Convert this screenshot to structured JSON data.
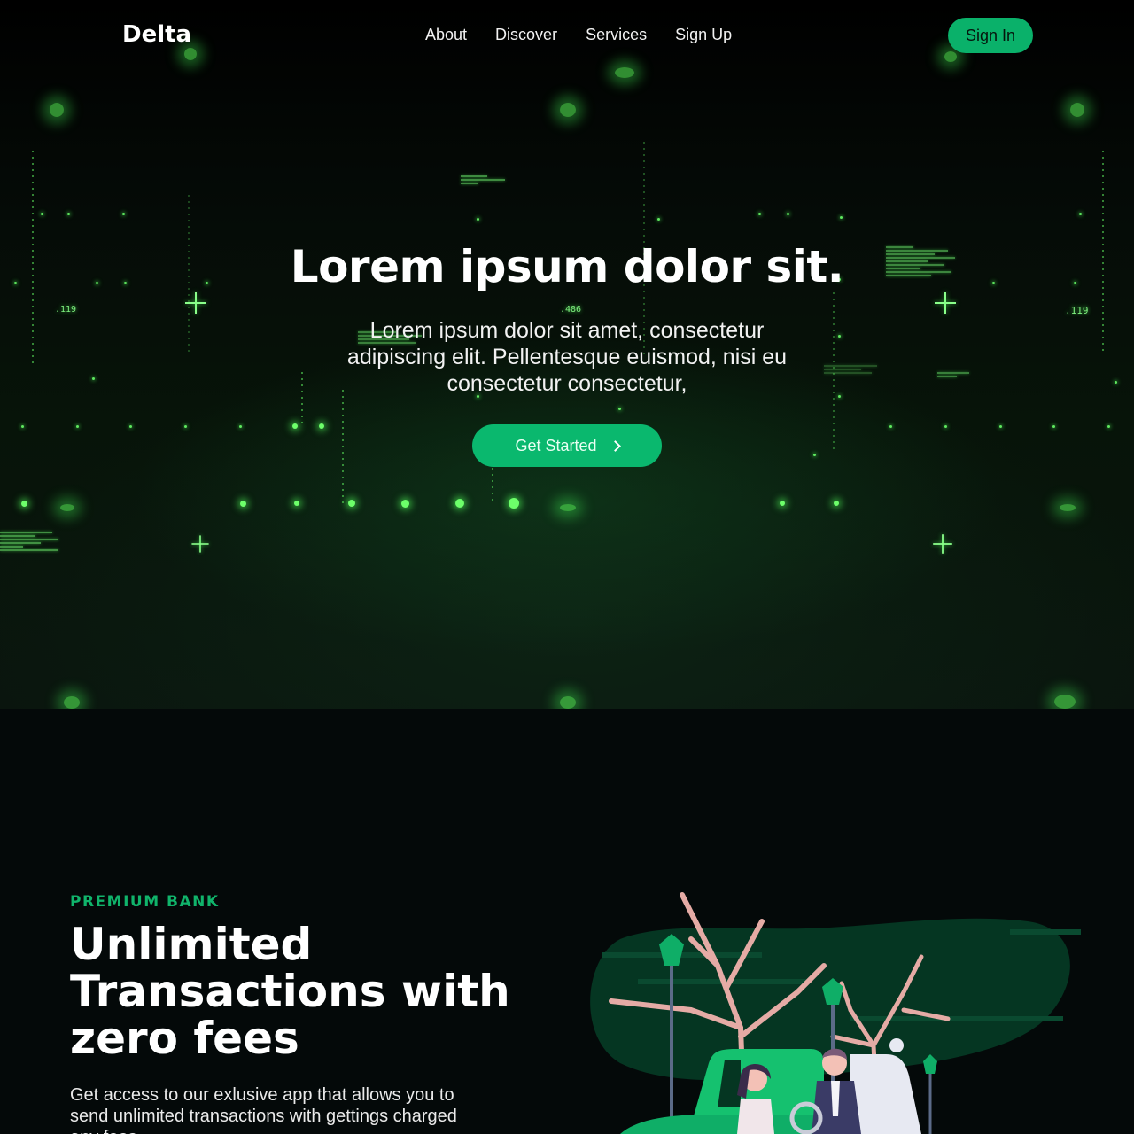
{
  "nav": {
    "logo": "Delta",
    "links": [
      "About",
      "Discover",
      "Services",
      "Sign Up"
    ],
    "signin_label": "Sign In"
  },
  "hero": {
    "title": "Lorem ipsum dolor sit.",
    "subtitle": "Lorem ipsum dolor sit amet, consectetur adipiscing elit. Pellentesque euismod, nisi eu consectetur consectetur,",
    "cta_label": "Get Started",
    "background_tags": [
      ".119",
      ".486",
      ".119"
    ]
  },
  "feature": {
    "eyebrow": "PREMIUM BANK",
    "title": "Unlimited Transactions with zero fees",
    "body": "Get access to our exlusive app that allows you to send unlimited transactions with gettings charged any fees"
  },
  "colors": {
    "accent": "#0ab86e",
    "eyebrow": "#10b46b",
    "background": "#040909",
    "glow": "#6dff6a"
  },
  "icons": {
    "cta_icon": "chevron-right-icon"
  }
}
